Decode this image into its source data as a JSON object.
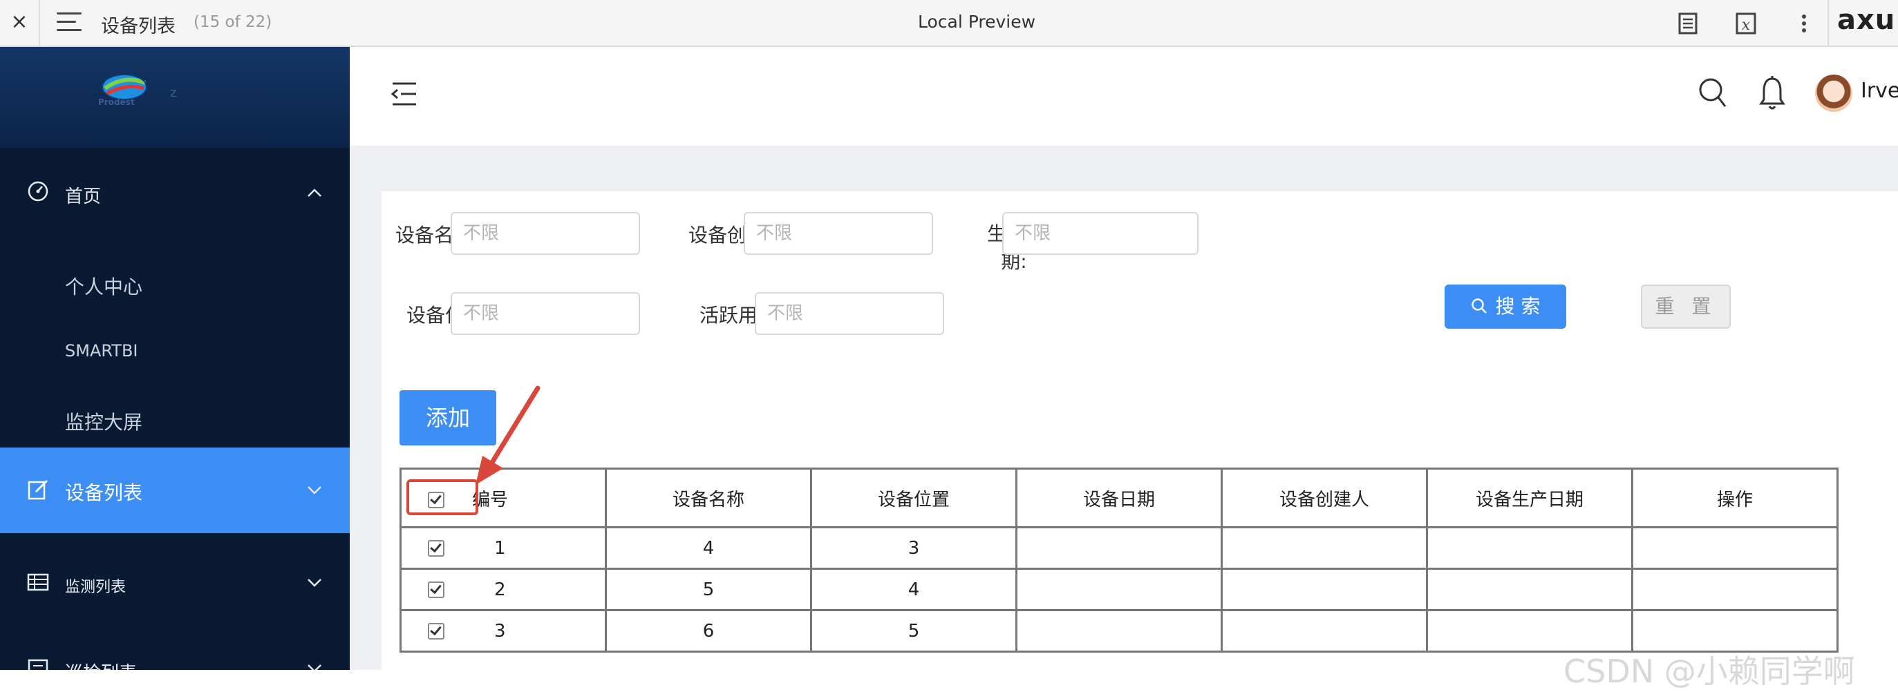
{
  "topbar": {
    "close_glyph": "×",
    "page_name": "设备列表",
    "page_count": "(15 of 22)",
    "window_title": "Local Preview",
    "brand": "axu",
    "icons": [
      "menu-icon",
      "notes-icon",
      "variable-icon",
      "more-icon"
    ]
  },
  "sidebar": {
    "logo_text": "Prodest",
    "logo_suffix": "z",
    "items": [
      {
        "label": "首页",
        "icon": "dashboard-icon",
        "expanded": true
      },
      {
        "label": "个人中心"
      },
      {
        "label": "SMARTBI"
      },
      {
        "label": "监控大屏"
      },
      {
        "label": "设备列表",
        "icon": "edit-icon",
        "active": true
      },
      {
        "label": "监测列表",
        "icon": "table-icon"
      },
      {
        "label": "巡检列表",
        "icon": "list-icon"
      }
    ]
  },
  "header": {
    "user_name": "Irver"
  },
  "filters": {
    "device_name_label": "设备名称:",
    "device_name_placeholder": "不限",
    "creator_label": "设备创建人",
    "creator_placeholder": "不限",
    "prod_date_label_line1": "生产日",
    "prod_date_label_line2": "期:",
    "prod_date_placeholder": "不限",
    "location_label": "设备位置",
    "location_placeholder": "不限",
    "active_user_label": "活跃用户:",
    "active_user_placeholder": "不限",
    "search_button": "搜 索",
    "reset_button": "重 置"
  },
  "add_button": "添加",
  "table": {
    "columns": [
      "编号",
      "设备名称",
      "设备位置",
      "设备日期",
      "设备创建人",
      "设备生产日期",
      "操作"
    ],
    "rows": [
      {
        "id": "1",
        "name": "4",
        "location": "3",
        "date": "",
        "creator": "",
        "prod_date": "",
        "ops": "",
        "checked": true
      },
      {
        "id": "2",
        "name": "5",
        "location": "4",
        "date": "",
        "creator": "",
        "prod_date": "",
        "ops": "",
        "checked": true
      },
      {
        "id": "3",
        "name": "6",
        "location": "5",
        "date": "",
        "creator": "",
        "prod_date": "",
        "ops": "",
        "checked": true
      }
    ]
  },
  "annotation_color": "#d9473a",
  "accent_color": "#3c8ef5",
  "watermark": "CSDN @小赖同学啊"
}
